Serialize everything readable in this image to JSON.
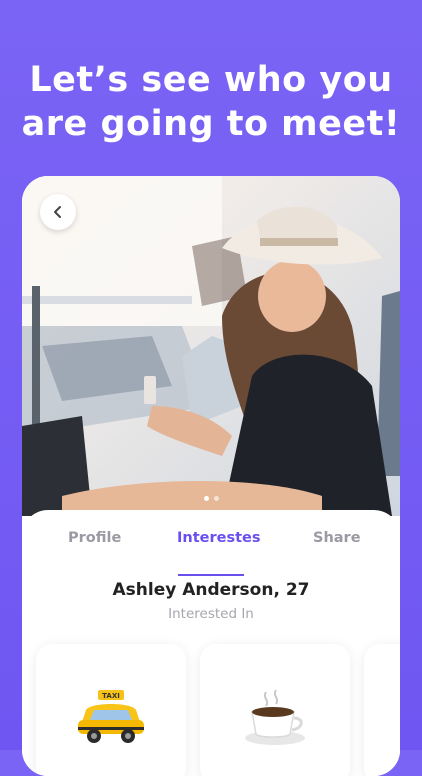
{
  "headline": {
    "line1": "Let’s see who you",
    "line2": "are going to meet!"
  },
  "profile": {
    "tabs": [
      {
        "label": "Profile"
      },
      {
        "label": "Interestes"
      },
      {
        "label": "Share"
      }
    ],
    "active_tab": "Interestes",
    "name": "Ashley Anderson, 27",
    "subtitle": "Interested In",
    "photo_pages": 2,
    "photo_current": 1,
    "interests": [
      {
        "icon": "taxi-icon",
        "text": "TAXI"
      },
      {
        "icon": "coffee-icon"
      },
      {
        "icon": "partial-card"
      }
    ]
  },
  "colors": {
    "background": "#7060f2",
    "accent": "#6a4ff0"
  }
}
